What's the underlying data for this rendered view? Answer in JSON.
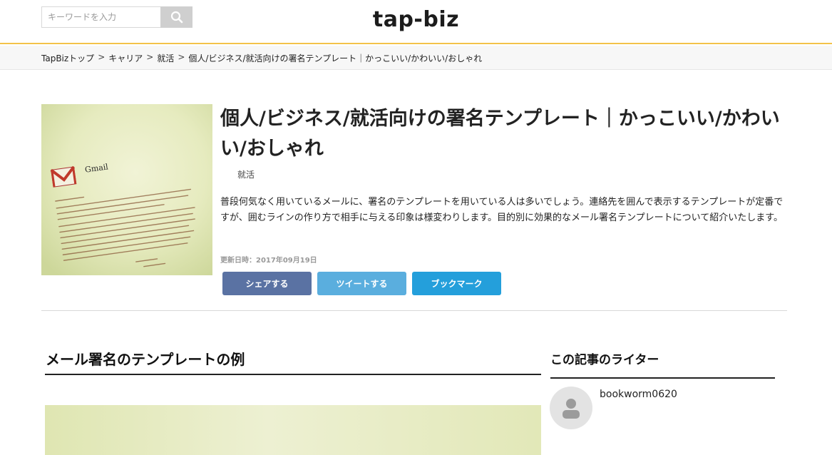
{
  "header": {
    "logo": "tap-biz",
    "search": {
      "placeholder": "キーワードを入力",
      "value": ""
    }
  },
  "breadcrumb": {
    "items": [
      "TapBizトップ",
      "キャリア",
      "就活",
      "個人/ビジネス/就活向けの署名テンプレート｜かっこいい/かわいい/おしゃれ"
    ],
    "separator": ">"
  },
  "article": {
    "title": "個人/ビジネス/就活向けの署名テンプレート｜かっこいい/かわいい/おしゃれ",
    "category": "就活",
    "lead": "普段何気なく用いているメールに、署名のテンプレートを用いている人は多いでしょう。連絡先を囲んで表示するテンプレートが定番ですが、囲むラインの作り方で相手に与える印象は様変わりします。目的別に効果的なメール署名テンプレートについて紹介いたします。",
    "updated": "更新日時：2017年09月19日",
    "thumb_brand_text": "Gmail"
  },
  "share": {
    "facebook": "シェアする",
    "twitter": "ツイートする",
    "bookmark": "ブックマーク"
  },
  "main": {
    "section_heading": "メール署名のテンプレートの例"
  },
  "sidebar": {
    "writer_heading": "この記事のライター",
    "writer_name": "bookworm0620"
  },
  "colors": {
    "header_accent": "#f3c24a",
    "facebook": "#5a72a3",
    "twitter": "#5aaede",
    "bookmark": "#249fdb"
  },
  "icons": {
    "search": "search-icon",
    "avatar": "user-silhouette-icon"
  }
}
